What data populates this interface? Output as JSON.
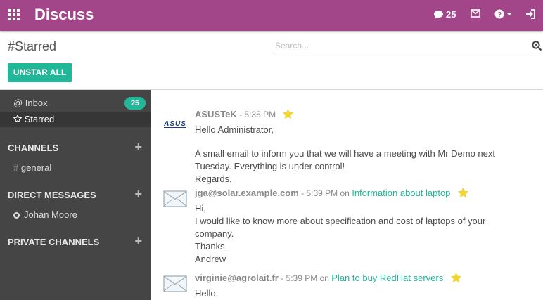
{
  "app": {
    "title": "Discuss"
  },
  "systray": {
    "message_count": "25"
  },
  "control_panel": {
    "breadcrumb": "#Starred",
    "search_placeholder": "Search...",
    "unstar_all_label": "UNSTAR ALL"
  },
  "sidebar": {
    "inbox": {
      "label": "@ Inbox",
      "counter": "25"
    },
    "starred": {
      "label": "Starred"
    },
    "channels": {
      "header": "CHANNELS",
      "items": [
        {
          "label": "general"
        }
      ]
    },
    "direct_messages": {
      "header": "DIRECT MESSAGES",
      "items": [
        {
          "label": "Johan Moore"
        }
      ]
    },
    "private_channels": {
      "header": "PRIVATE CHANNELS"
    }
  },
  "messages": [
    {
      "author": "ASUSTeK",
      "time": "- 5:35 PM",
      "avatar_text": "ASUS",
      "lines": [
        "Hello Administrator,",
        "",
        "A small email to inform you that we will have a meeting with Mr Demo next",
        "Tuesday. Everything is under control!",
        "Regards,"
      ]
    },
    {
      "author": "jga@solar.example.com",
      "time": "- 5:39 PM on",
      "record": "Information about laptop",
      "lines": [
        "Hi,",
        "I would like to know more about specification and cost of laptops of your",
        "company.",
        "Thanks,",
        "Andrew"
      ]
    },
    {
      "author": "virginie@agrolait.fr",
      "time": "- 5:39 PM on",
      "record": "Plan to buy RedHat servers",
      "lines": [
        "Hello,"
      ]
    }
  ],
  "colors": {
    "topbar": "#a24689",
    "accent": "#21b799",
    "sidebar": "#454545",
    "star": "#f0d431"
  }
}
